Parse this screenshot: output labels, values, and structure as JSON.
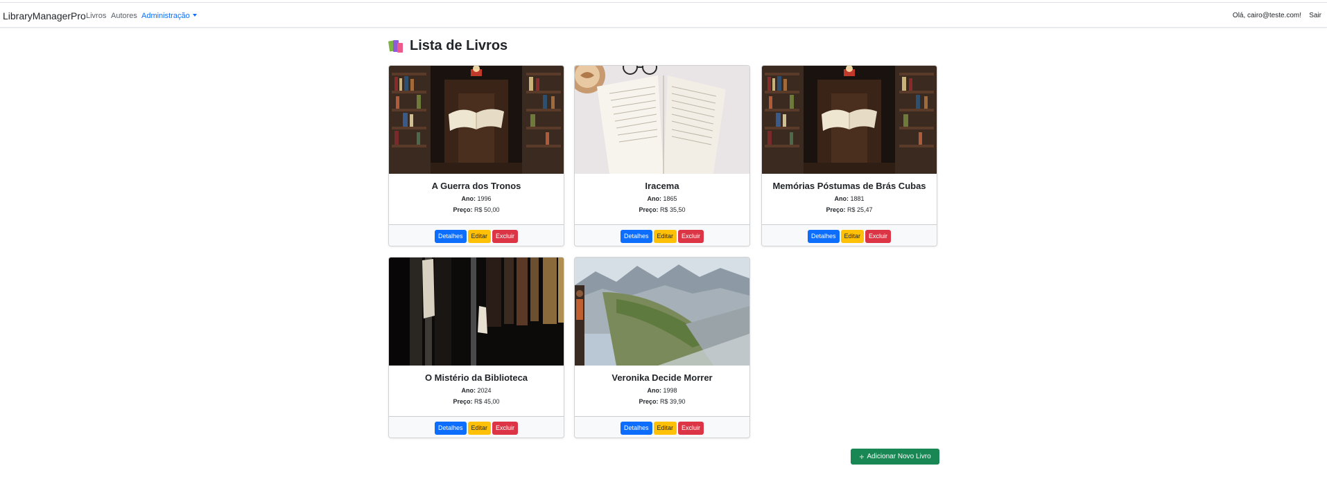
{
  "navbar": {
    "brand": "LibraryManagerPro",
    "links": [
      "Livros",
      "Autores"
    ],
    "dropdown": "Administração",
    "greeting": "Olá, cairo@teste.com!",
    "logout": "Sair"
  },
  "page": {
    "title": "Lista de Livros",
    "add_button": "Adicionar Novo Livro"
  },
  "labels": {
    "year": "Ano:",
    "price": "Preço:",
    "details": "Detalhes",
    "edit": "Editar",
    "delete": "Excluir"
  },
  "books": [
    {
      "title": "A Guerra dos Tronos",
      "year": "1996",
      "price": "R$ 50,00",
      "image": "library-floating-book"
    },
    {
      "title": "Iracema",
      "year": "1865",
      "price": "R$ 35,50",
      "image": "open-book-coffee"
    },
    {
      "title": "Memórias Póstumas de Brás Cubas",
      "year": "1881",
      "price": "R$ 25,47",
      "image": "library-floating-book"
    },
    {
      "title": "O Mistério da Biblioteca",
      "year": "2024",
      "price": "R$ 45,00",
      "image": "dark-bookshelf"
    },
    {
      "title": "Veronika Decide Morrer",
      "year": "1998",
      "price": "R$ 39,90",
      "image": "mountain-landscape"
    }
  ],
  "colors": {
    "primary": "#0d6efd",
    "warning": "#ffc107",
    "danger": "#dc3545",
    "success": "#198754"
  }
}
